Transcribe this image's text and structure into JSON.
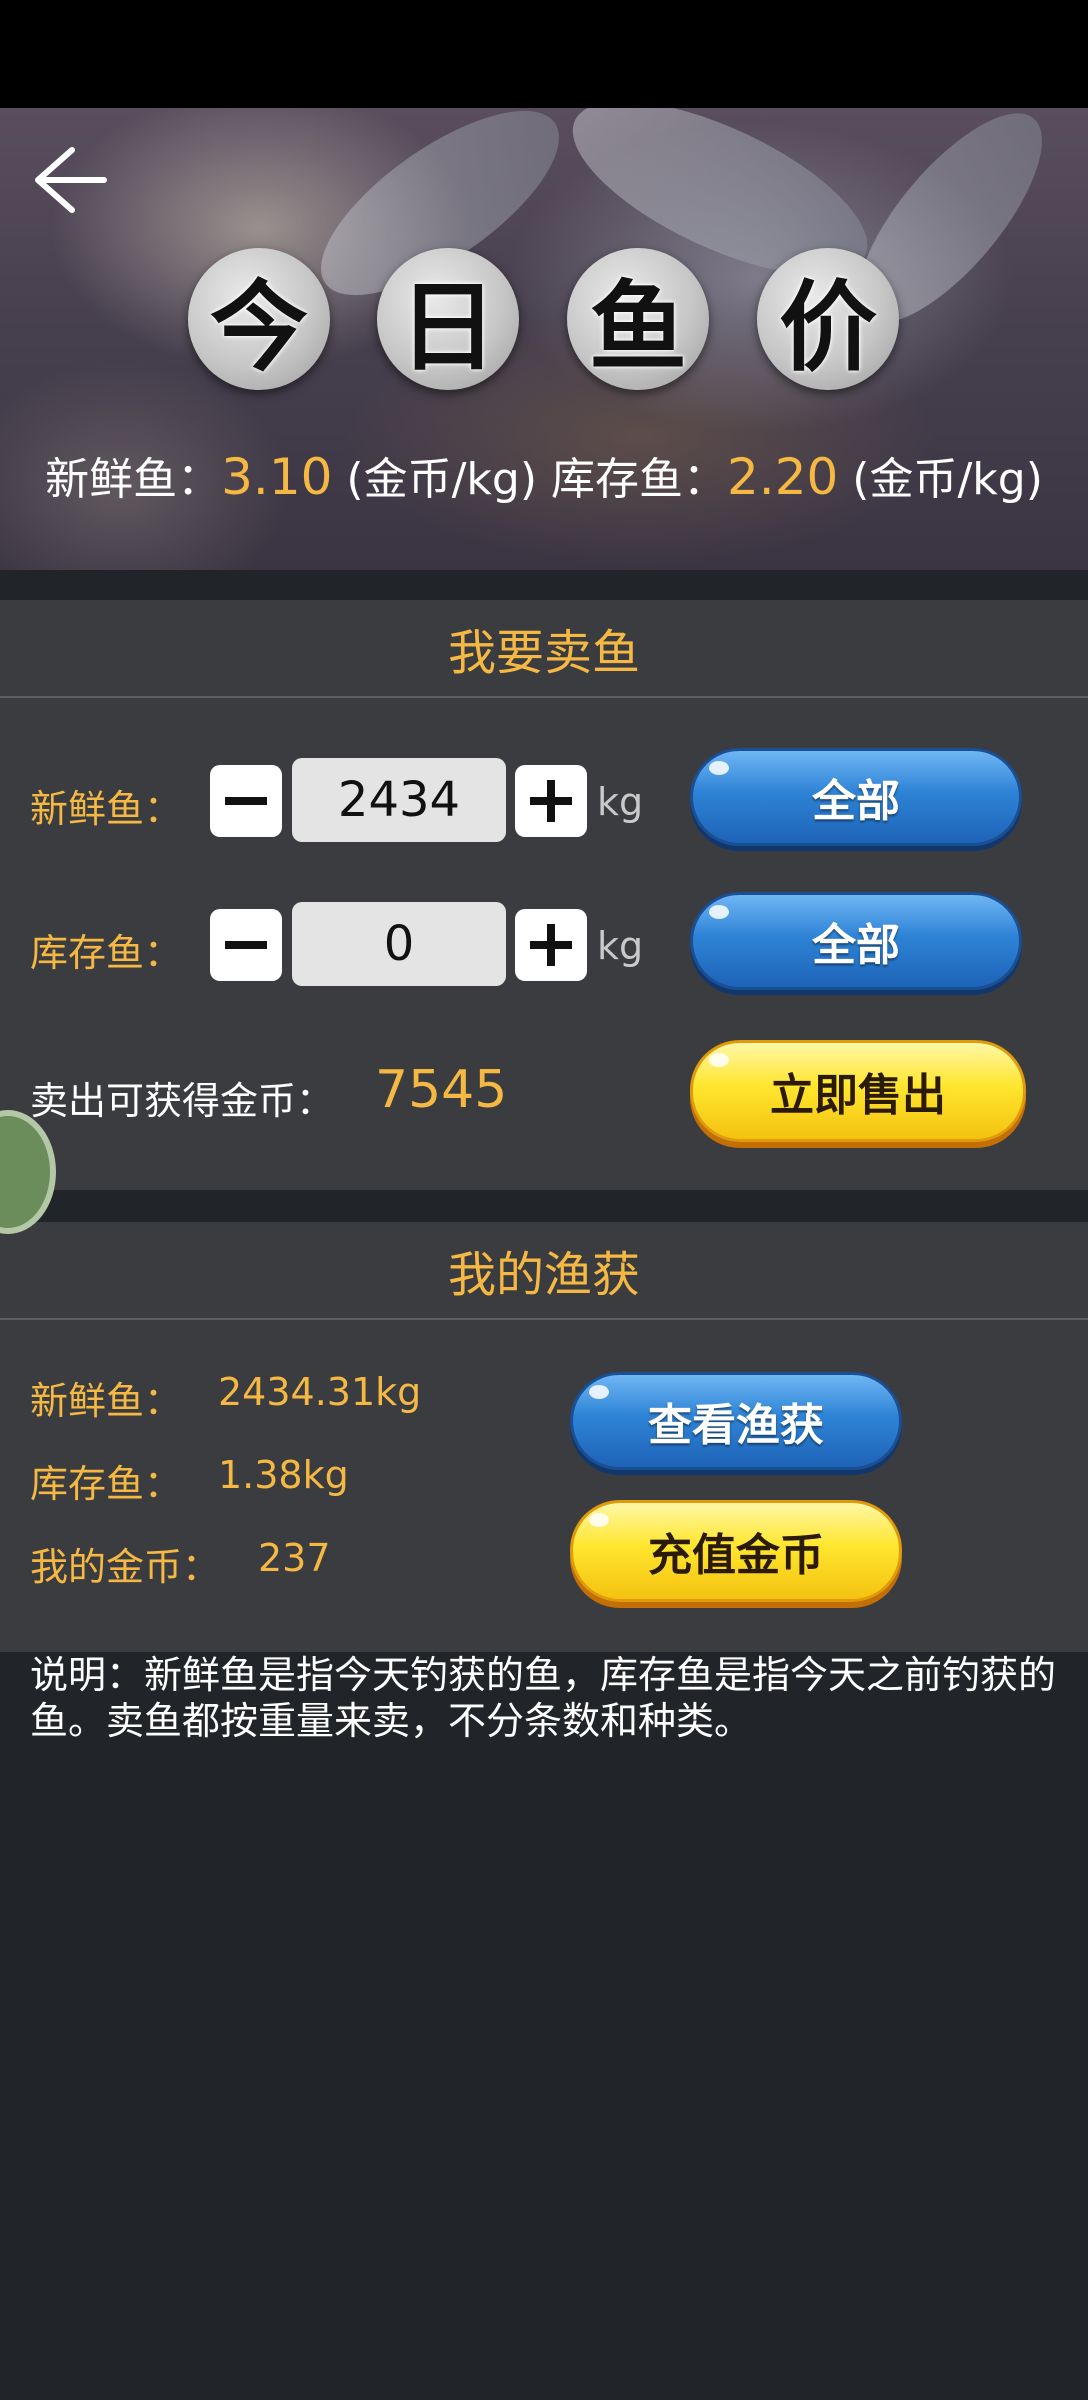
{
  "header": {
    "title_chars": [
      "今",
      "日",
      "鱼",
      "价"
    ],
    "fresh_label": "新鲜鱼：",
    "fresh_price": "3.10",
    "fresh_unit": " (金币/kg) ",
    "stock_label": "库存鱼：",
    "stock_price": "2.20",
    "stock_unit": " (金币/kg)"
  },
  "sell": {
    "title": "我要卖鱼",
    "fresh_label": "新鲜鱼：",
    "fresh_qty": "2434",
    "stock_label": "库存鱼：",
    "stock_qty": "0",
    "unit": "kg",
    "all_label": "全部",
    "earn_label": "卖出可获得金币：",
    "earn_value": "7545",
    "sell_now_label": "立即售出"
  },
  "catch": {
    "title": "我的渔获",
    "fresh_label": "新鲜鱼：",
    "fresh_value": "2434.31kg",
    "stock_label": "库存鱼：",
    "stock_value": "1.38kg",
    "coins_label": "我的金币：",
    "coins_value": "237",
    "view_label": "查看渔获",
    "recharge_label": "充值金币"
  },
  "note": "说明：新鲜鱼是指今天钓获的鱼，库存鱼是指今天之前钓获的鱼。卖鱼都按重量来卖，不分条数和种类。",
  "colors": {
    "accent": "#f4b843",
    "section_bg": "#3b3c40",
    "page_bg": "#212429",
    "blue_button": "#2e83d6",
    "yellow_button": "#ffe62e"
  },
  "icons": [
    "back-arrow-icon",
    "minus-icon",
    "plus-icon"
  ]
}
